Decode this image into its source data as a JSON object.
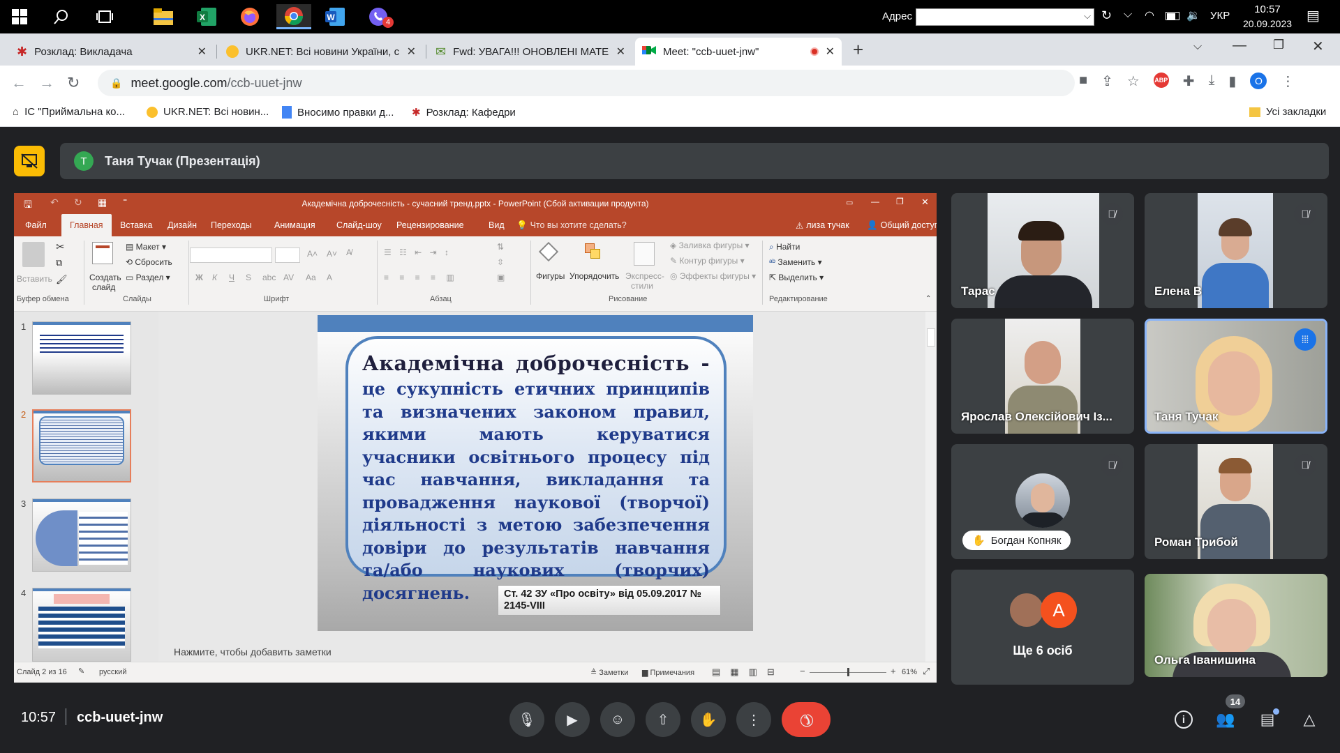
{
  "taskbar": {
    "start_icon": "windows-logo-icon",
    "address_label": "Адрес",
    "lang": "УКР",
    "time": "10:57",
    "date": "20.09.2023",
    "viber_badge": "4"
  },
  "browser": {
    "tabs": [
      {
        "title": "Розклад: Викладача",
        "icon": "schedule-icon"
      },
      {
        "title": "UKR.NET: Всі новини України, с",
        "icon": "ukrnet-icon"
      },
      {
        "title": "Fwd: УВАГА!!! ОНОВЛЕНІ МАТЕ",
        "icon": "mail-icon"
      },
      {
        "title": "Meet: \"ccb-uuet-jnw\"",
        "icon": "meet-icon",
        "active": true
      }
    ],
    "url_host": "meet.google.com",
    "url_path": "/ccb-uuet-jnw",
    "profile_initial": "O",
    "bookmarks": [
      "ІС \"Приймальна ко...",
      "UKR.NET: Всі новин...",
      "Вносимо правки д...",
      "Розклад: Кафедри"
    ],
    "all_bookmarks": "Усі закладки"
  },
  "meet": {
    "presenter_initial": "T",
    "presenter_label": "Таня Тучак (Презентація)",
    "meeting_time": "10:57",
    "meeting_code": "ccb-uuet-jnw",
    "people_count": "14",
    "participants": [
      {
        "name": "Тарас",
        "muted": true
      },
      {
        "name": "Елена В",
        "muted": true
      },
      {
        "name": "Ярослав Олексійович Із...",
        "muted": false
      },
      {
        "name": "Таня Тучак",
        "muted": false,
        "speaking": true
      },
      {
        "name": "Богдан Копняк",
        "muted": true
      },
      {
        "name": "Роман Трибой",
        "muted": true
      },
      {
        "name": "Ще 6 осіб",
        "avatar_initial": "А"
      },
      {
        "name": "Ольга Іванишина",
        "muted": false
      }
    ]
  },
  "ppt": {
    "window_title": "Академічна доброчесність - сучасний тренд.pptx - PowerPoint (Сбой активации продукта)",
    "ribbon_tabs": [
      "Файл",
      "Главная",
      "Вставка",
      "Дизайн",
      "Переходы",
      "Анимация",
      "Слайд-шоу",
      "Рецензирование",
      "Вид"
    ],
    "tell_me": "Что вы хотите сделать?",
    "user": "лиза тучак",
    "share": "Общий доступ",
    "ribbon": {
      "paste": "Вставить",
      "new_slide_1": "Создать",
      "new_slide_2": "слайд",
      "layout": "Макет",
      "reset": "Сбросить",
      "section": "Раздел",
      "shapes": "Фигуры",
      "arrange": "Упорядочить",
      "quick_styles_1": "Экспресс-",
      "quick_styles_2": "стили",
      "fill": "Заливка фигуры",
      "outline": "Контур фигуры",
      "effects": "Эффекты фигуры",
      "find": "Найти",
      "replace": "Заменить",
      "select": "Выделить",
      "groups": [
        "Буфер обмена",
        "Слайды",
        "Шрифт",
        "Абзац",
        "Рисование",
        "Редактирование"
      ]
    },
    "slide_numbers": [
      "1",
      "2",
      "3",
      "4"
    ],
    "slide": {
      "heading": "Академічна доброчесність -",
      "body": "це сукупність етичних принципів та визначених законом правил, якими мають керуватися учасники освітнього процесу під час навчання, викладання та провадження наукової (творчої) діяльності з метою забезпечення довіри до результатів навчання та/або наукових (творчих) досягнень.",
      "reference": "Ст. 42 ЗУ «Про освіту» від 05.09.2017 № 2145-VIII"
    },
    "notes_placeholder": "Нажмите, чтобы добавить заметки",
    "status": {
      "slide_of": "Слайд 2 из 16",
      "language": "русский",
      "notes": "Заметки",
      "comments": "Примечания",
      "zoom": "61%"
    }
  }
}
